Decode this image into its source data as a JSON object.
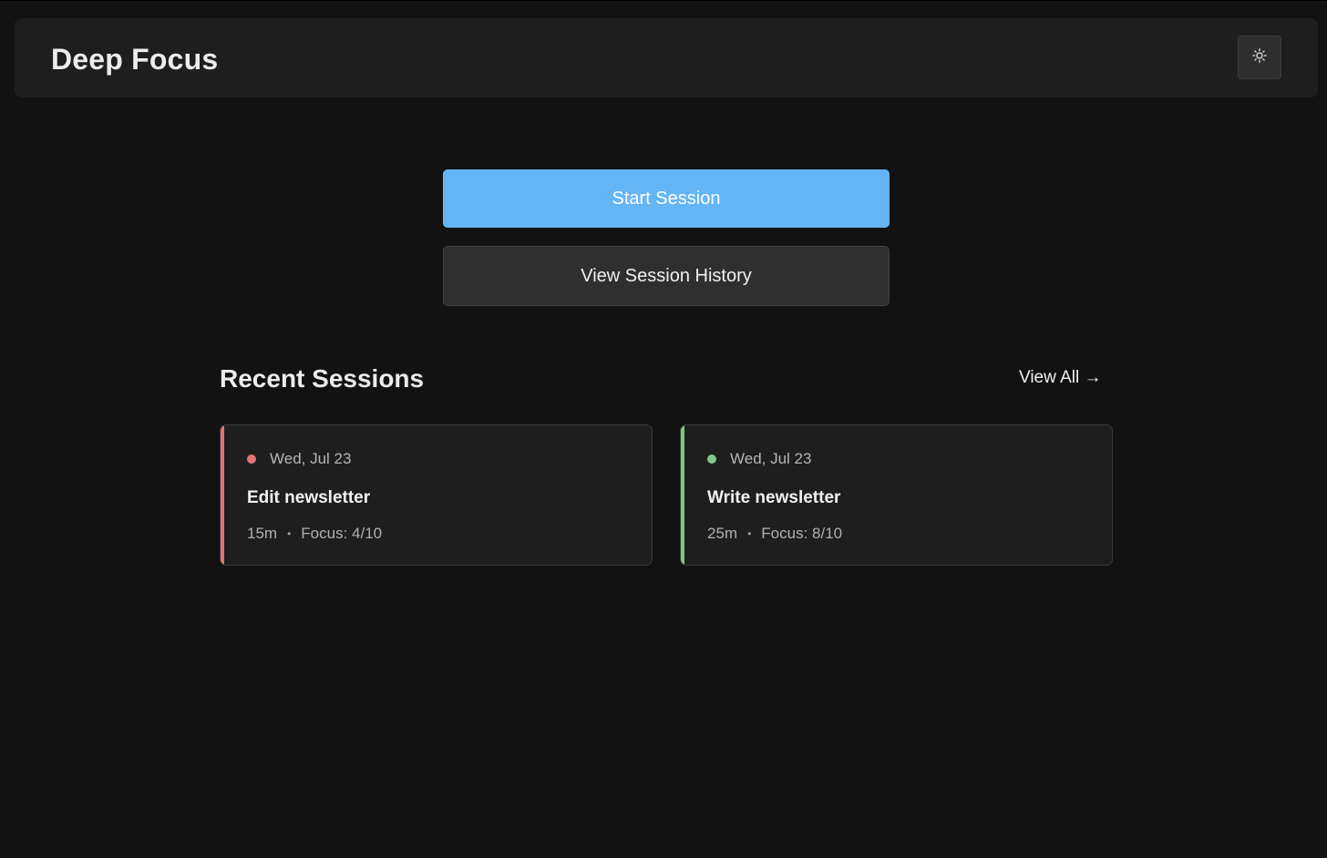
{
  "header": {
    "title": "Deep Focus",
    "theme_toggle_icon": "sun-icon"
  },
  "actions": {
    "start_label": "Start Session",
    "history_label": "View Session History",
    "primary_color": "#64b5f6"
  },
  "recent": {
    "title": "Recent Sessions",
    "view_all_label": "View All →",
    "sessions": [
      {
        "date": "Wed, Jul 23",
        "title": "Edit newsletter",
        "duration": "15m",
        "separator": "•",
        "focus": "Focus: 4/10",
        "status_color": "#e57373"
      },
      {
        "date": "Wed, Jul 23",
        "title": "Write newsletter",
        "duration": "25m",
        "separator": "•",
        "focus": "Focus: 8/10",
        "status_color": "#81c784"
      }
    ]
  }
}
